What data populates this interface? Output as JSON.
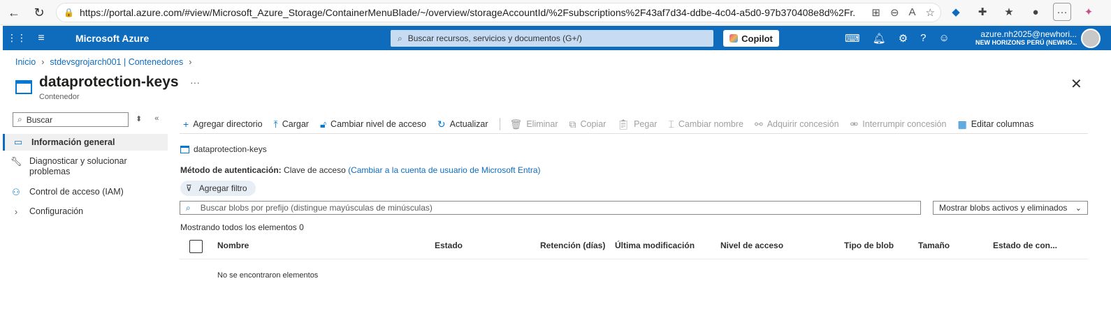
{
  "browser": {
    "url": "https://portal.azure.com/#view/Microsoft_Azure_Storage/ContainerMenuBlade/~/overview/storageAccountId/%2Fsubscriptions%2F43af7d34-ddbe-4c04-a5d0-97b370408e8d%2Fr..."
  },
  "azure": {
    "brand": "Microsoft Azure",
    "search_placeholder": "Buscar recursos, servicios y documentos (G+/)",
    "copilot_label": "Copilot",
    "account_email": "azure.nh2025@newhori...",
    "account_org": "NEW HORIZONS PERÚ (NEWHO..."
  },
  "breadcrumb": {
    "items": [
      "Inicio",
      "stdevsgrojarch001 | Contenedores"
    ]
  },
  "page": {
    "title": "dataprotection-keys",
    "subtitle": "Contenedor",
    "more": "···"
  },
  "left_menu": {
    "search_placeholder": "Buscar",
    "items": [
      {
        "label": "Información general",
        "icon": "overview-icon"
      },
      {
        "label": "Diagnosticar y solucionar problemas",
        "icon": "wrench-icon"
      },
      {
        "label": "Control de acceso (IAM)",
        "icon": "people-icon"
      },
      {
        "label": "Configuración",
        "icon": "chevron-right-icon"
      }
    ]
  },
  "toolbar": {
    "add_directory": "Agregar directorio",
    "upload": "Cargar",
    "change_access": "Cambiar nivel de acceso",
    "refresh": "Actualizar",
    "delete": "Eliminar",
    "copy": "Copiar",
    "paste": "Pegar",
    "rename": "Cambiar nombre",
    "acquire_lease": "Adquirir concesión",
    "break_lease": "Interrumpir concesión",
    "edit_columns": "Editar columnas"
  },
  "content": {
    "path_label": "dataprotection-keys",
    "auth_label": "Método de autenticación:",
    "auth_value": "Clave de acceso",
    "auth_link": "(Cambiar a la cuenta de usuario de Microsoft Entra)",
    "add_filter": "Agregar filtro",
    "blob_search_placeholder": "Buscar blobs por prefijo (distingue mayúsculas de minúsculas)",
    "blob_view_select": "Mostrar blobs activos y eliminados",
    "showing": "Mostrando todos los elementos 0",
    "columns": [
      "Nombre",
      "Estado",
      "Retención (días)",
      "Última modificación",
      "Nivel de acceso",
      "Tipo de blob",
      "Tamaño",
      "Estado de con..."
    ],
    "empty_message": "No se encontraron elementos"
  }
}
